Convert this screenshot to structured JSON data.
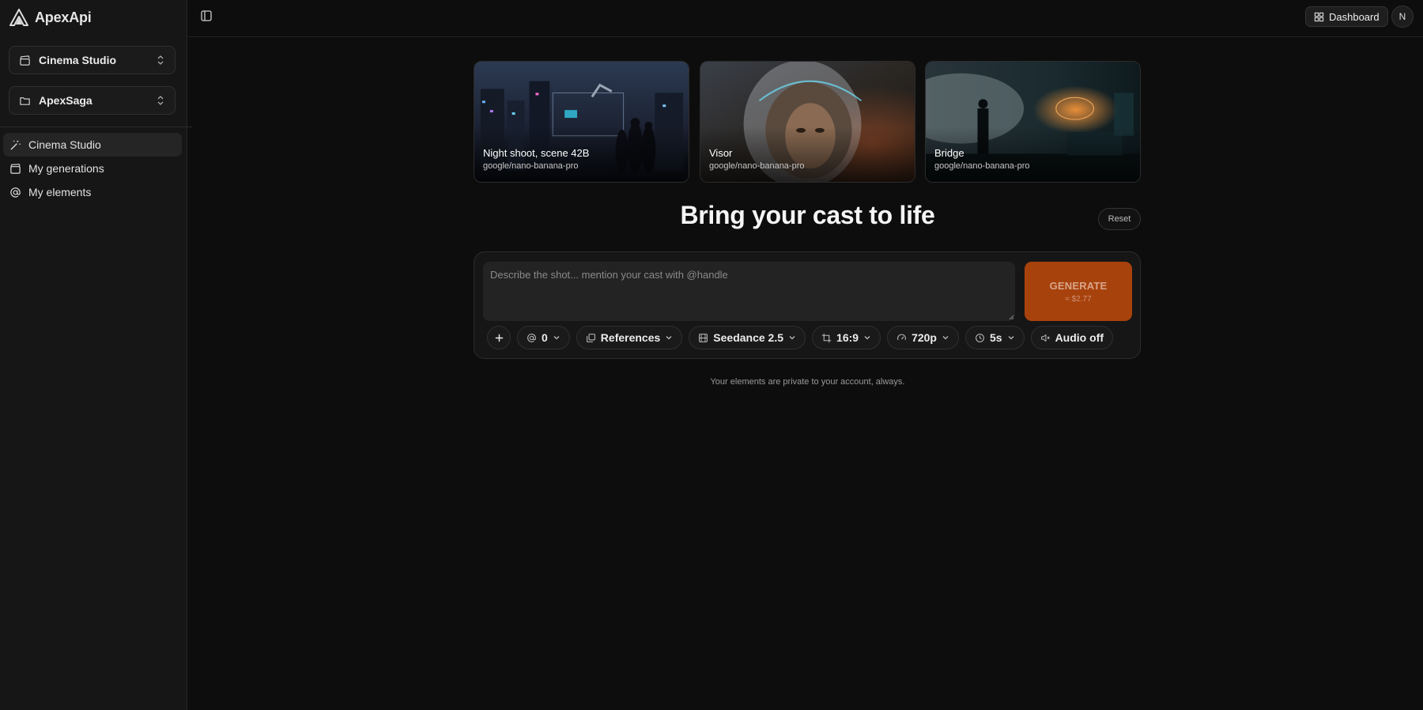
{
  "app": {
    "name": "ApexApi"
  },
  "sidebar": {
    "workspace_selector": {
      "label": "Cinema Studio",
      "icon": "clapperboard-icon"
    },
    "project_selector": {
      "label": "ApexSaga",
      "icon": "folder-icon"
    },
    "nav": [
      {
        "label": "Cinema Studio",
        "icon": "magic-wand-icon",
        "active": true
      },
      {
        "label": "My generations",
        "icon": "film-icon",
        "active": false
      },
      {
        "label": "My elements",
        "icon": "at-sign-icon",
        "active": false
      }
    ]
  },
  "header": {
    "dashboard_label": "Dashboard",
    "avatar_initial": "N"
  },
  "cards": [
    {
      "title": "Night shoot, scene 42B",
      "model": "google/nano-banana-pro"
    },
    {
      "title": "Visor",
      "model": "google/nano-banana-pro"
    },
    {
      "title": "Bridge",
      "model": "google/nano-banana-pro"
    }
  ],
  "main": {
    "headline": "Bring your cast to life",
    "reset_label": "Reset",
    "prompt_placeholder": "Describe the shot... mention your cast with @handle",
    "generate": {
      "label": "GENERATE",
      "cost": "≈ $2.77"
    },
    "toolbar": {
      "mentions_count": "0",
      "references": "References",
      "model": "Seedance 2.5",
      "aspect": "16:9",
      "resolution": "720p",
      "duration": "5s",
      "audio": "Audio off"
    },
    "footnote": "Your elements are private to your account, always."
  },
  "colors": {
    "accent": "#a8420d",
    "background": "#0d0d0d",
    "sidebar": "#161616"
  }
}
